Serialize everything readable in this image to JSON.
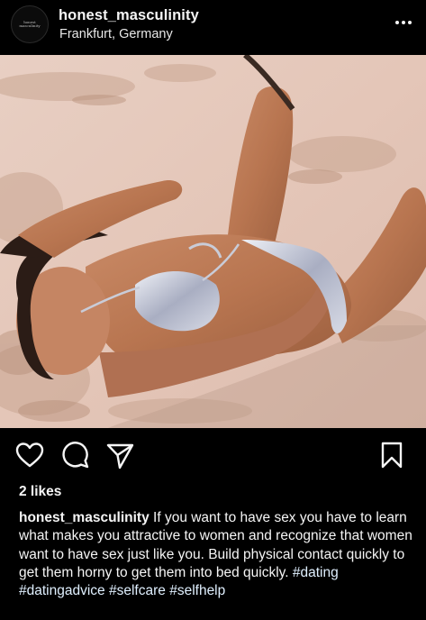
{
  "post": {
    "username": "honest_masculinity",
    "location": "Frankfurt, Germany",
    "avatar_text": "honest\nmasculinity",
    "likes": "2 likes",
    "caption_user": "honest_masculinity",
    "caption_text": " If you want to have sex you have to learn what makes you attractive to women and recognize that women want to have sex just like you. Build physical contact quickly to get them horny to get them into bed quickly. ",
    "hashtags": [
      "#dating",
      "#datingadvice",
      "#selfcare",
      "#selfhelp"
    ]
  },
  "icons": {
    "more": "more-options-icon",
    "like": "heart-icon",
    "comment": "comment-icon",
    "share": "send-icon",
    "save": "bookmark-icon"
  },
  "colors": {
    "background": "#000000",
    "text": "#f5f5f5",
    "sand": "#e3c9bd"
  }
}
